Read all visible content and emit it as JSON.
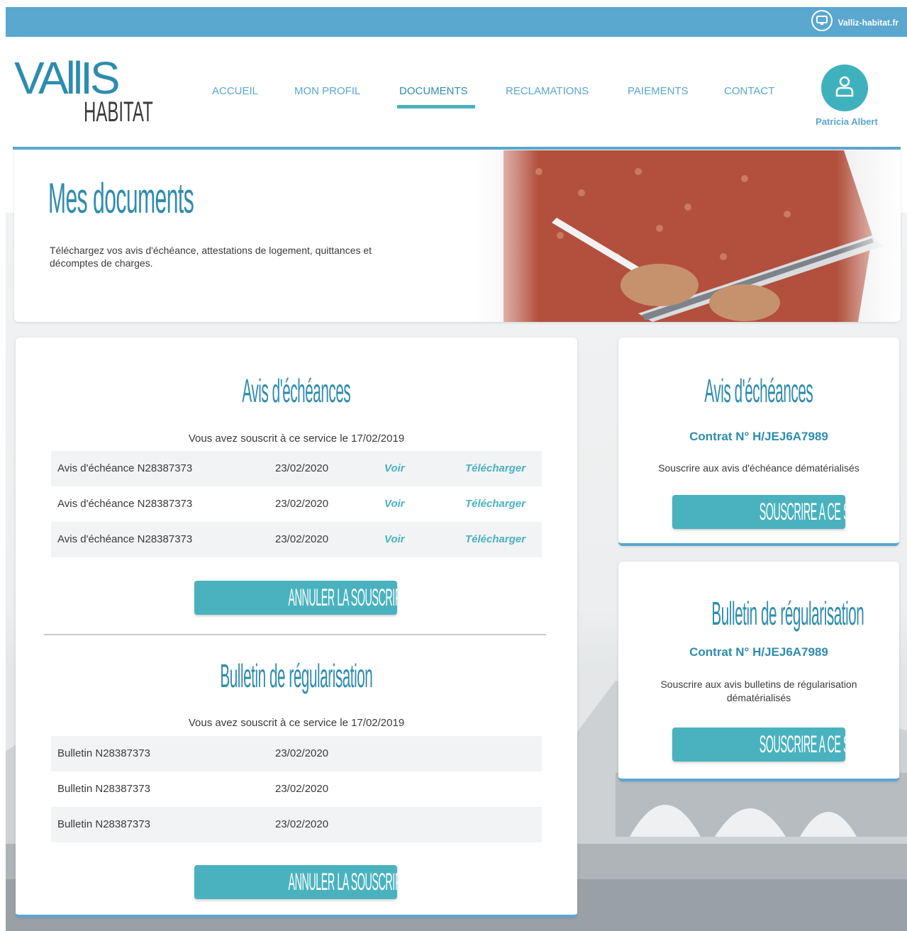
{
  "topbar": {
    "site_label": "Valliz-habitat.fr",
    "icon": "monitor-icon"
  },
  "logo": {
    "main": "VAllIS",
    "sub": "HABITAT"
  },
  "nav": {
    "items": [
      {
        "label": "ACCUEIL",
        "active": false
      },
      {
        "label": "MON PROFIL",
        "active": false
      },
      {
        "label": "DOCUMENTS",
        "active": true
      },
      {
        "label": "RECLAMATIONS",
        "active": false
      },
      {
        "label": "PAIEMENTS",
        "active": false
      },
      {
        "label": "CONTACT",
        "active": false
      }
    ]
  },
  "user": {
    "name": "Patricia Albert",
    "icon": "user-icon"
  },
  "hero": {
    "title": "Mes documents",
    "text": "Téléchargez vos avis d'échéance, attestations de logement, quittances et décomptes de charges."
  },
  "avis": {
    "title": "Avis d'échéances",
    "subscribed": "Vous avez souscrit à ce service le 17/02/2019",
    "rows": [
      {
        "name": "Avis d'échéance N28387373",
        "date": "23/02/2020",
        "view": "Voir",
        "download": "Télécharger"
      },
      {
        "name": "Avis d'échéance N28387373",
        "date": "23/02/2020",
        "view": "Voir",
        "download": "Télécharger"
      },
      {
        "name": "Avis d'échéance N28387373",
        "date": "23/02/2020",
        "view": "Voir",
        "download": "Télécharger"
      }
    ],
    "cancel_label": "ANNULER LA SOUSCRIPTION"
  },
  "bulletin": {
    "title": "Bulletin de régularisation",
    "subscribed": "Vous avez souscrit à ce service le 17/02/2019",
    "rows": [
      {
        "name": "Bulletin N28387373",
        "date": "23/02/2020"
      },
      {
        "name": "Bulletin N28387373",
        "date": "23/02/2020"
      },
      {
        "name": "Bulletin N28387373",
        "date": "23/02/2020"
      }
    ],
    "cancel_label": "ANNULER LA SOUSCRIPTION"
  },
  "side_avis": {
    "title": "Avis d'échéances",
    "contract": "Contrat N° H/JEJ6A7989",
    "desc": "Souscrire aux avis d'échéance dématérialisés",
    "button": "SOUSCRIRE A CE SERVICE"
  },
  "side_bulletin": {
    "title": "Bulletin de régularisation",
    "contract": "Contrat N° H/JEJ6A7989",
    "desc": "Souscrire aux avis bulletins de régularisation dématérialisés",
    "button": "SOUSCRIRE A CE SERVICE"
  },
  "colors": {
    "accent": "#5aa7cf",
    "teal": "#4ab2bf",
    "title_blue": "#2e8cae"
  }
}
